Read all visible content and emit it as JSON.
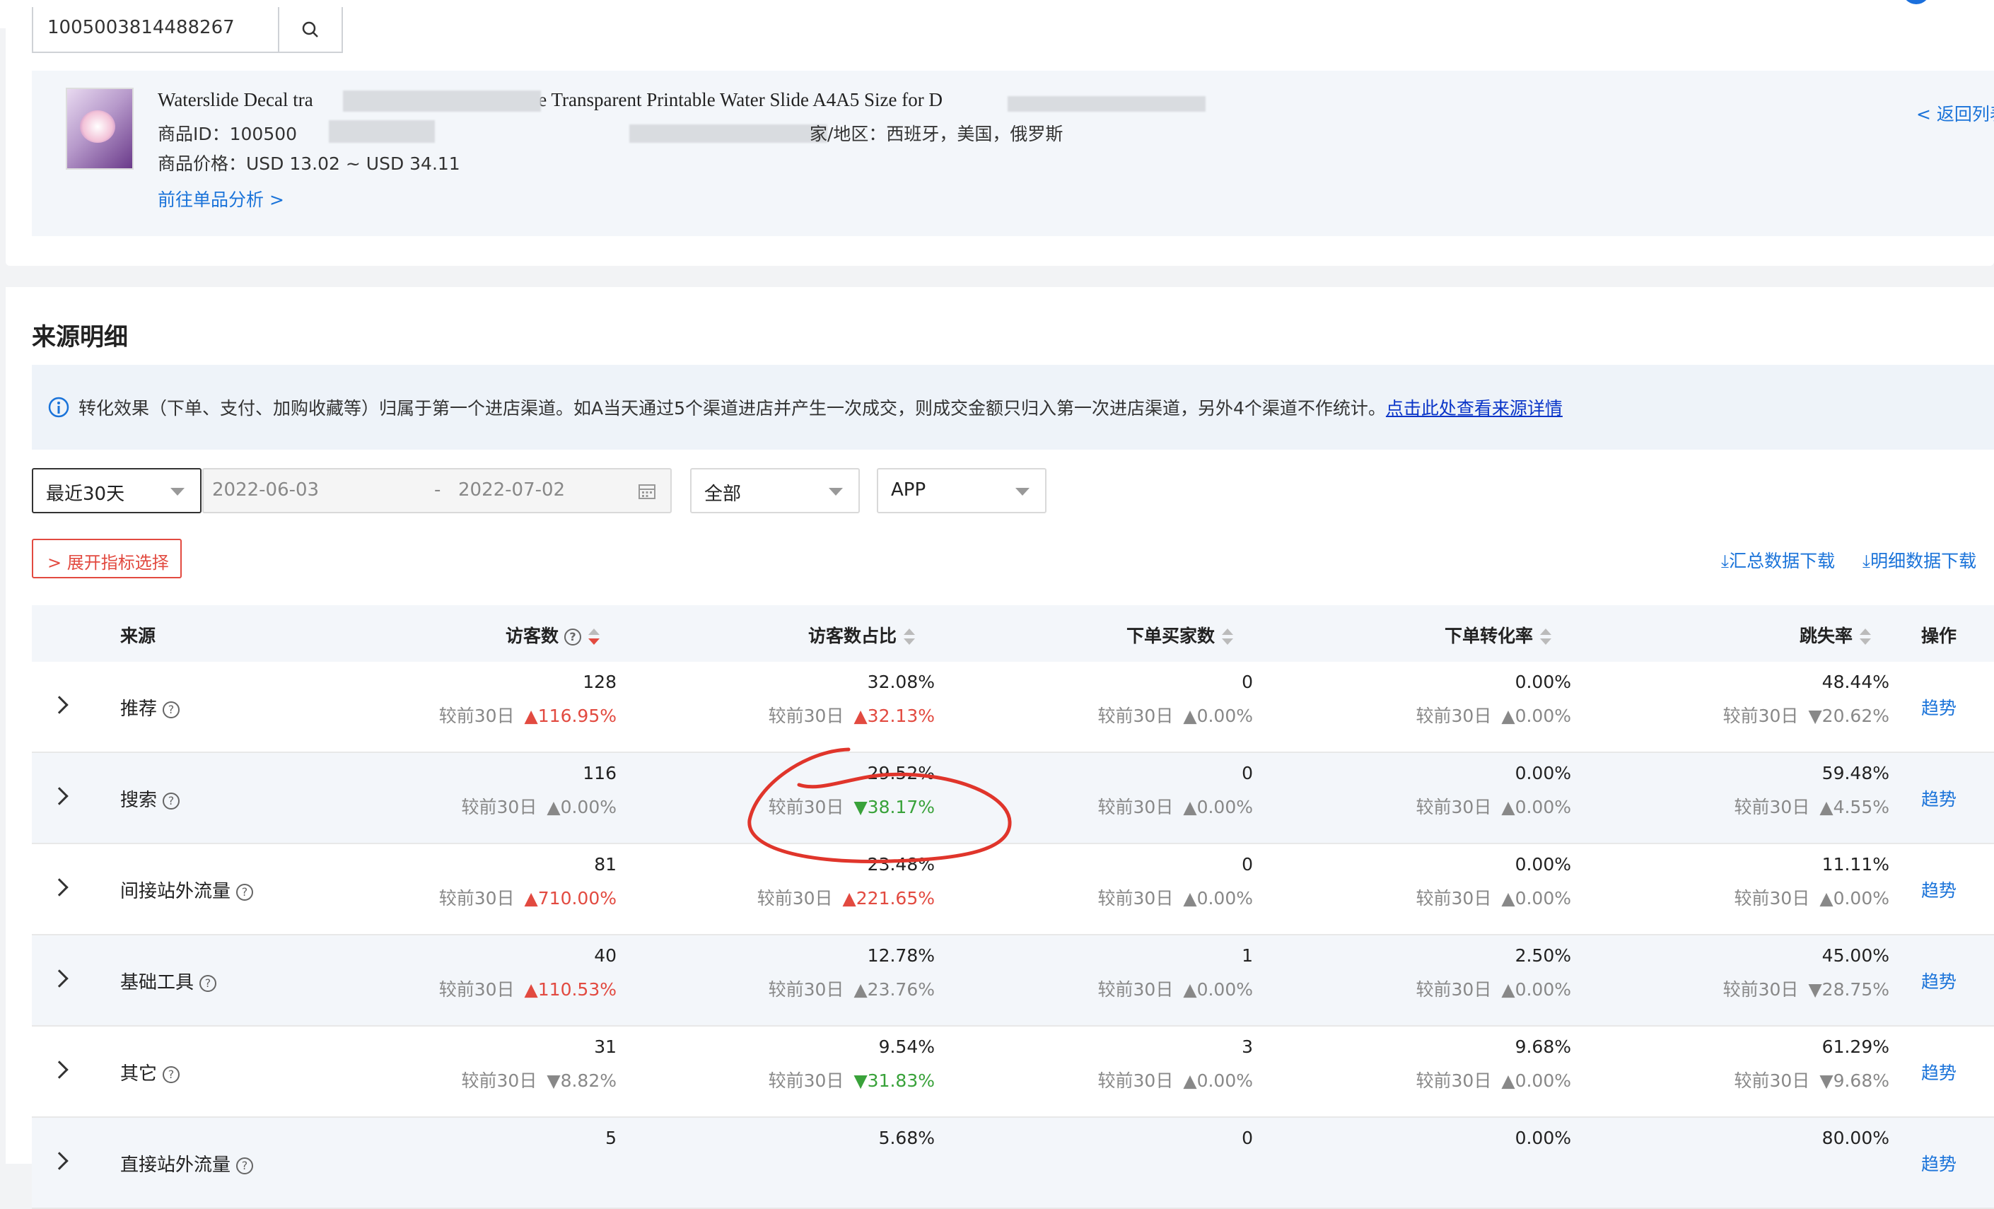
{
  "search": {
    "value": "1005003814488267"
  },
  "product": {
    "title_left": "Waterslide Decal tra",
    "title_right": "hite Transparent Printable Water Slide A4A5 Size for D",
    "id_label": "商品ID：",
    "id_value": "100500",
    "region_suffix": "家/地区：西班牙，美国，俄罗斯",
    "price": "商品价格：USD 13.02 ~ USD 34.11",
    "analysis_link": "前往单品分析 >",
    "back_link": "< 返回列表"
  },
  "section": {
    "title": "来源明细",
    "notice": "转化效果（下单、支付、加购收藏等）归属于第一个进店渠道。如A当天通过5个渠道进店并产生一次成交，则成交金额只归入第一次进店渠道，另外4个渠道不作统计。",
    "notice_link": "点击此处查看来源详情"
  },
  "filters": {
    "period": "最近30天",
    "date_start": "2022-06-03",
    "date_sep": "-",
    "date_end": "2022-07-02",
    "scope": "全部",
    "platform": "APP",
    "expand": "展开指标选择",
    "download_summary": "汇总数据下载",
    "download_detail": "明细数据下载"
  },
  "table": {
    "headers": {
      "source": "来源",
      "visitors": "访客数",
      "share": "访客数占比",
      "buyers": "下单买家数",
      "conv": "下单转化率",
      "bounce": "跳失率",
      "action": "操作"
    },
    "compare_label": "较前30日",
    "trend_label": "趋势",
    "rows": [
      {
        "name": "推荐",
        "visitors": "128",
        "visitors_cmp": "▲116.95%",
        "visitors_dir": "up",
        "share": "32.08%",
        "share_cmp": "▲32.13%",
        "share_dir": "up",
        "buyers": "0",
        "buyers_cmp": "▲0.00%",
        "buyers_dir": "flat",
        "conv": "0.00%",
        "conv_cmp": "▲0.00%",
        "conv_dir": "flat",
        "bounce": "48.44%",
        "bounce_cmp": "▼20.62%",
        "bounce_dir": "flat"
      },
      {
        "name": "搜索",
        "visitors": "116",
        "visitors_cmp": "▲0.00%",
        "visitors_dir": "flat",
        "share": "29.52%",
        "share_cmp": "▼38.17%",
        "share_dir": "down",
        "buyers": "0",
        "buyers_cmp": "▲0.00%",
        "buyers_dir": "flat",
        "conv": "0.00%",
        "conv_cmp": "▲0.00%",
        "conv_dir": "flat",
        "bounce": "59.48%",
        "bounce_cmp": "▲4.55%",
        "bounce_dir": "flat"
      },
      {
        "name": "间接站外流量",
        "visitors": "81",
        "visitors_cmp": "▲710.00%",
        "visitors_dir": "up",
        "share": "23.48%",
        "share_cmp": "▲221.65%",
        "share_dir": "up",
        "buyers": "0",
        "buyers_cmp": "▲0.00%",
        "buyers_dir": "flat",
        "conv": "0.00%",
        "conv_cmp": "▲0.00%",
        "conv_dir": "flat",
        "bounce": "11.11%",
        "bounce_cmp": "▲0.00%",
        "bounce_dir": "flat"
      },
      {
        "name": "基础工具",
        "visitors": "40",
        "visitors_cmp": "▲110.53%",
        "visitors_dir": "up",
        "share": "12.78%",
        "share_cmp": "▲23.76%",
        "share_dir": "flat",
        "buyers": "1",
        "buyers_cmp": "▲0.00%",
        "buyers_dir": "flat",
        "conv": "2.50%",
        "conv_cmp": "▲0.00%",
        "conv_dir": "flat",
        "bounce": "45.00%",
        "bounce_cmp": "▼28.75%",
        "bounce_dir": "flat"
      },
      {
        "name": "其它",
        "visitors": "31",
        "visitors_cmp": "▼8.82%",
        "visitors_dir": "flat",
        "share": "9.54%",
        "share_cmp": "▼31.83%",
        "share_dir": "down",
        "buyers": "3",
        "buyers_cmp": "▲0.00%",
        "buyers_dir": "flat",
        "conv": "9.68%",
        "conv_cmp": "▲0.00%",
        "conv_dir": "flat",
        "bounce": "61.29%",
        "bounce_cmp": "▼9.68%",
        "bounce_dir": "flat"
      },
      {
        "name": "直接站外流量",
        "visitors": "5",
        "visitors_cmp": "",
        "visitors_dir": "flat",
        "share": "5.68%",
        "share_cmp": "",
        "share_dir": "flat",
        "buyers": "0",
        "buyers_cmp": "",
        "buyers_dir": "flat",
        "conv": "0.00%",
        "conv_cmp": "",
        "conv_dir": "flat",
        "bounce": "80.00%",
        "bounce_cmp": "",
        "bounce_dir": "flat"
      }
    ]
  }
}
